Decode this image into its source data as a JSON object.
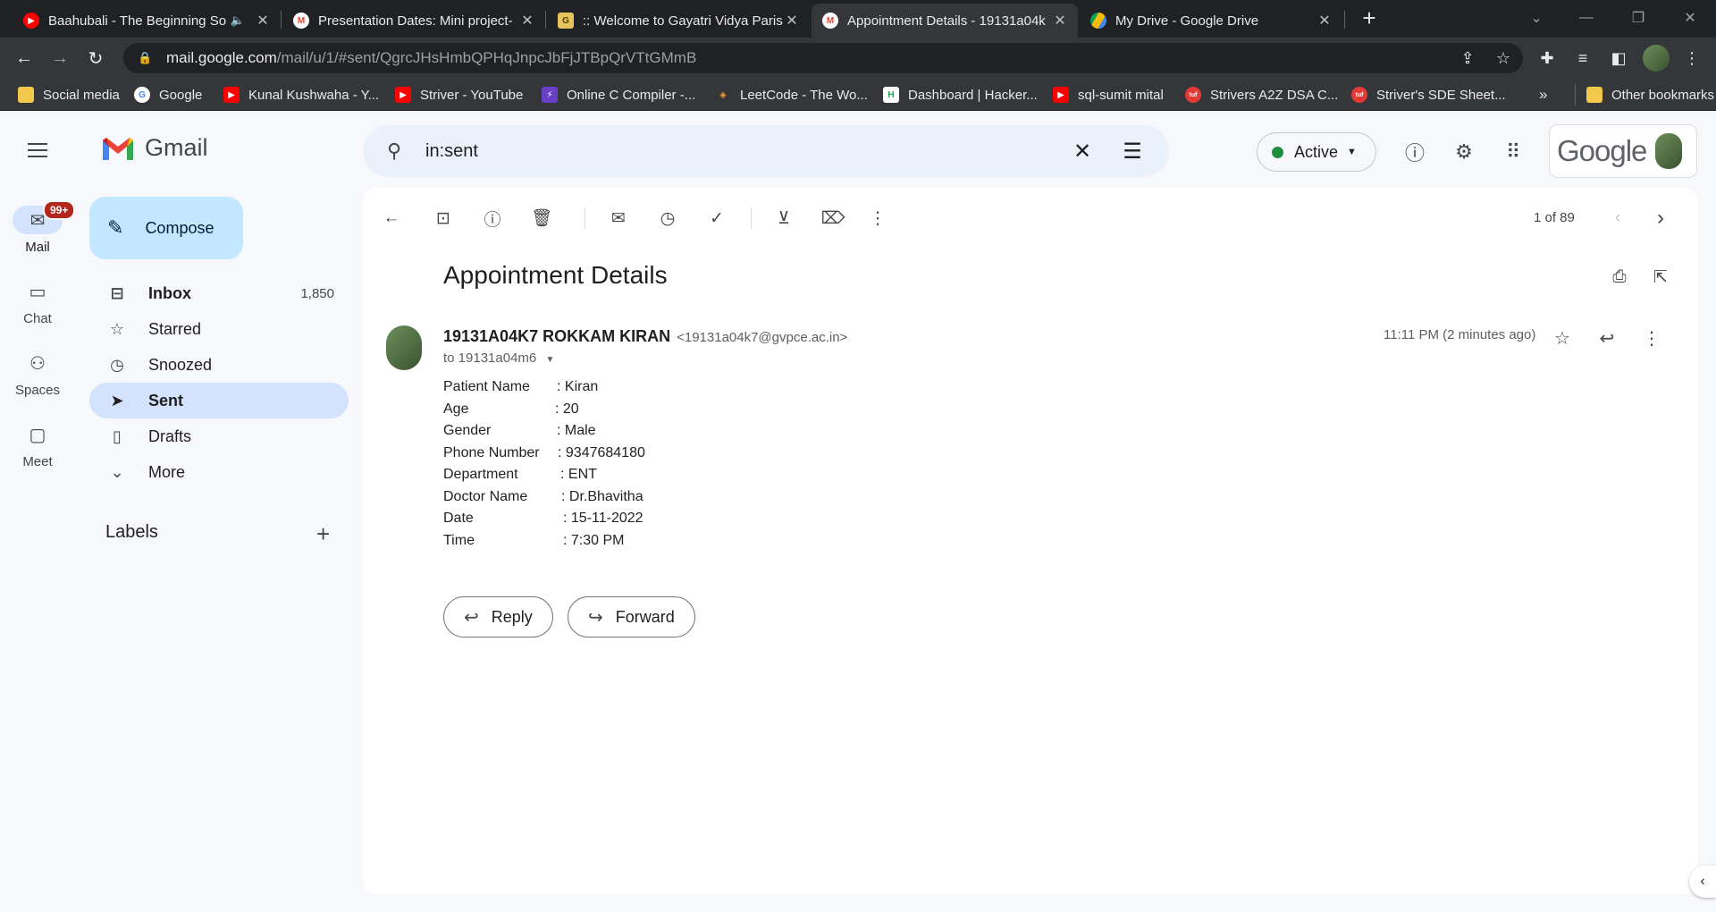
{
  "browser": {
    "tabs": [
      {
        "title": "Baahubali - The Beginning So",
        "favicon": "youtube-icon"
      },
      {
        "title": "Presentation Dates: Mini project-",
        "favicon": "gmail-icon"
      },
      {
        "title": ":: Welcome to Gayatri Vidya Paris",
        "favicon": "college-icon"
      },
      {
        "title": "Appointment Details - 19131a04k",
        "favicon": "gmail-icon"
      },
      {
        "title": "My Drive - Google Drive",
        "favicon": "drive-icon"
      }
    ],
    "url_host": "mail.google.com",
    "url_path": "/mail/u/1/#sent/QgrcJHsHmbQPHqJnpcJbFjJTBpQrVTtGMmB",
    "bookmarks": [
      "Social media",
      "Google",
      "Kunal Kushwaha - Y...",
      "Striver - YouTube",
      "Online C Compiler -...",
      "LeetCode - The Wo...",
      "Dashboard | Hacker...",
      "sql-sumit mital",
      "Strivers A2Z DSA C...",
      "Striver's SDE Sheet..."
    ],
    "bookmarks_more": "»",
    "other_bookmarks": "Other bookmarks"
  },
  "gmail": {
    "logo_text": "Gmail",
    "rail": {
      "mail": "Mail",
      "mail_badge": "99+",
      "chat": "Chat",
      "spaces": "Spaces",
      "meet": "Meet"
    },
    "compose": "Compose",
    "nav": {
      "inbox": "Inbox",
      "inbox_count": "1,850",
      "starred": "Starred",
      "snoozed": "Snoozed",
      "sent": "Sent",
      "drafts": "Drafts",
      "more": "More"
    },
    "labels_heading": "Labels",
    "search_value": "in:sent",
    "status": "Active",
    "google_word": "Google",
    "pager": "1 of 89",
    "message": {
      "subject": "Appointment Details",
      "sender_name": "19131A04K7 ROKKAM KIRAN",
      "sender_email": "<19131a04k7@gvpce.ac.in>",
      "to": "to 19131a04m6",
      "time": "11:11 PM (2 minutes ago)",
      "details": [
        {
          "label": "Patient Name",
          "value": ": Kiran"
        },
        {
          "label": "Age",
          "value": ": 20"
        },
        {
          "label": "Gender",
          "value": ": Male"
        },
        {
          "label": "Phone Number",
          "value": ": 9347684180"
        },
        {
          "label": "Department",
          "value": ": ENT"
        },
        {
          "label": "Doctor Name",
          "value": ": Dr.Bhavitha"
        },
        {
          "label": "Date",
          "value": ": 15-11-2022"
        },
        {
          "label": "Time",
          "value": ": 7:30 PM"
        }
      ]
    },
    "reply_label": "Reply",
    "forward_label": "Forward"
  },
  "colors": {
    "accent": "#0b57d0",
    "selected_nav": "#d3e3fd",
    "compose_bg": "#c2e7ff",
    "active_dot": "#1e8e3e",
    "badge": "#b3261e"
  }
}
